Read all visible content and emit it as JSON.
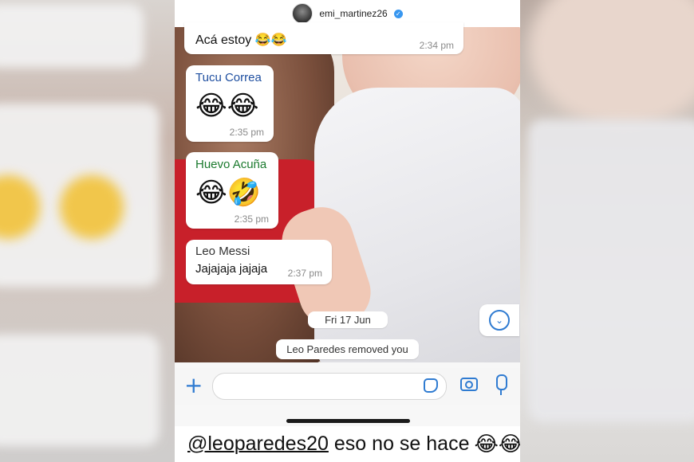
{
  "header": {
    "username": "emi_martinez26",
    "verified_icon": "verified-badge-icon"
  },
  "messages": [
    {
      "sender": "",
      "text": "Acá estoy 😂😂",
      "time": "2:34 pm"
    },
    {
      "sender": "Tucu Correa",
      "text": "😂😂",
      "time": "2:35 pm",
      "sender_color": "#1f4fa0"
    },
    {
      "sender": "Huevo Acuña",
      "text": "😂🤣",
      "time": "2:35 pm",
      "sender_color": "#1b7a2e"
    },
    {
      "sender": "Leo Messi",
      "text": "Jajajaja jajaja",
      "time": "2:37 pm",
      "sender_color": "#333333"
    }
  ],
  "date_separator": "Fri 17 Jun",
  "system_notice": "Leo Paredes removed you",
  "input": {
    "placeholder": ""
  },
  "caption": {
    "mention": "@leoparedes20",
    "text": "eso no se hace",
    "emoji": "😂😂"
  },
  "colors": {
    "accent": "#2f7bd1"
  }
}
